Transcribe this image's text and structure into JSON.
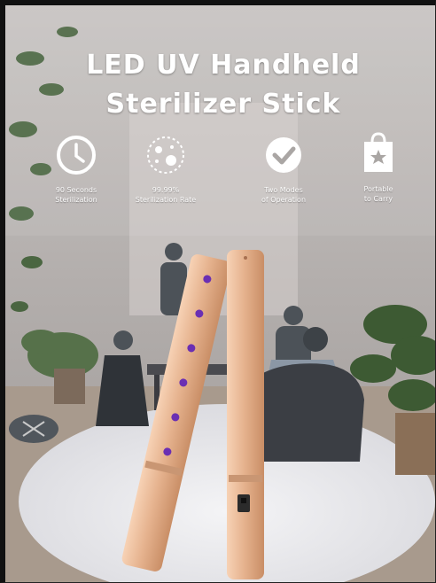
{
  "headline": {
    "line1": "LED UV Handheld",
    "line2": "Sterilizer Stick"
  },
  "features": [
    {
      "icon": "clock-icon",
      "line1": "90 Seconds",
      "line2": "Sterilization"
    },
    {
      "icon": "virus-icon",
      "line1": "99.99%",
      "line2": "Sterilization Rate"
    },
    {
      "icon": "checkmark-icon",
      "line1": "Two Modes",
      "line2": "of Operation"
    },
    {
      "icon": "shopping-bag-icon",
      "line1": "Portable",
      "line2": "to Carry"
    }
  ],
  "colors": {
    "background": "#b9b4b2",
    "stick": "#e3b08d",
    "uv_led": "#6a2fb3",
    "text": "#ffffff"
  }
}
